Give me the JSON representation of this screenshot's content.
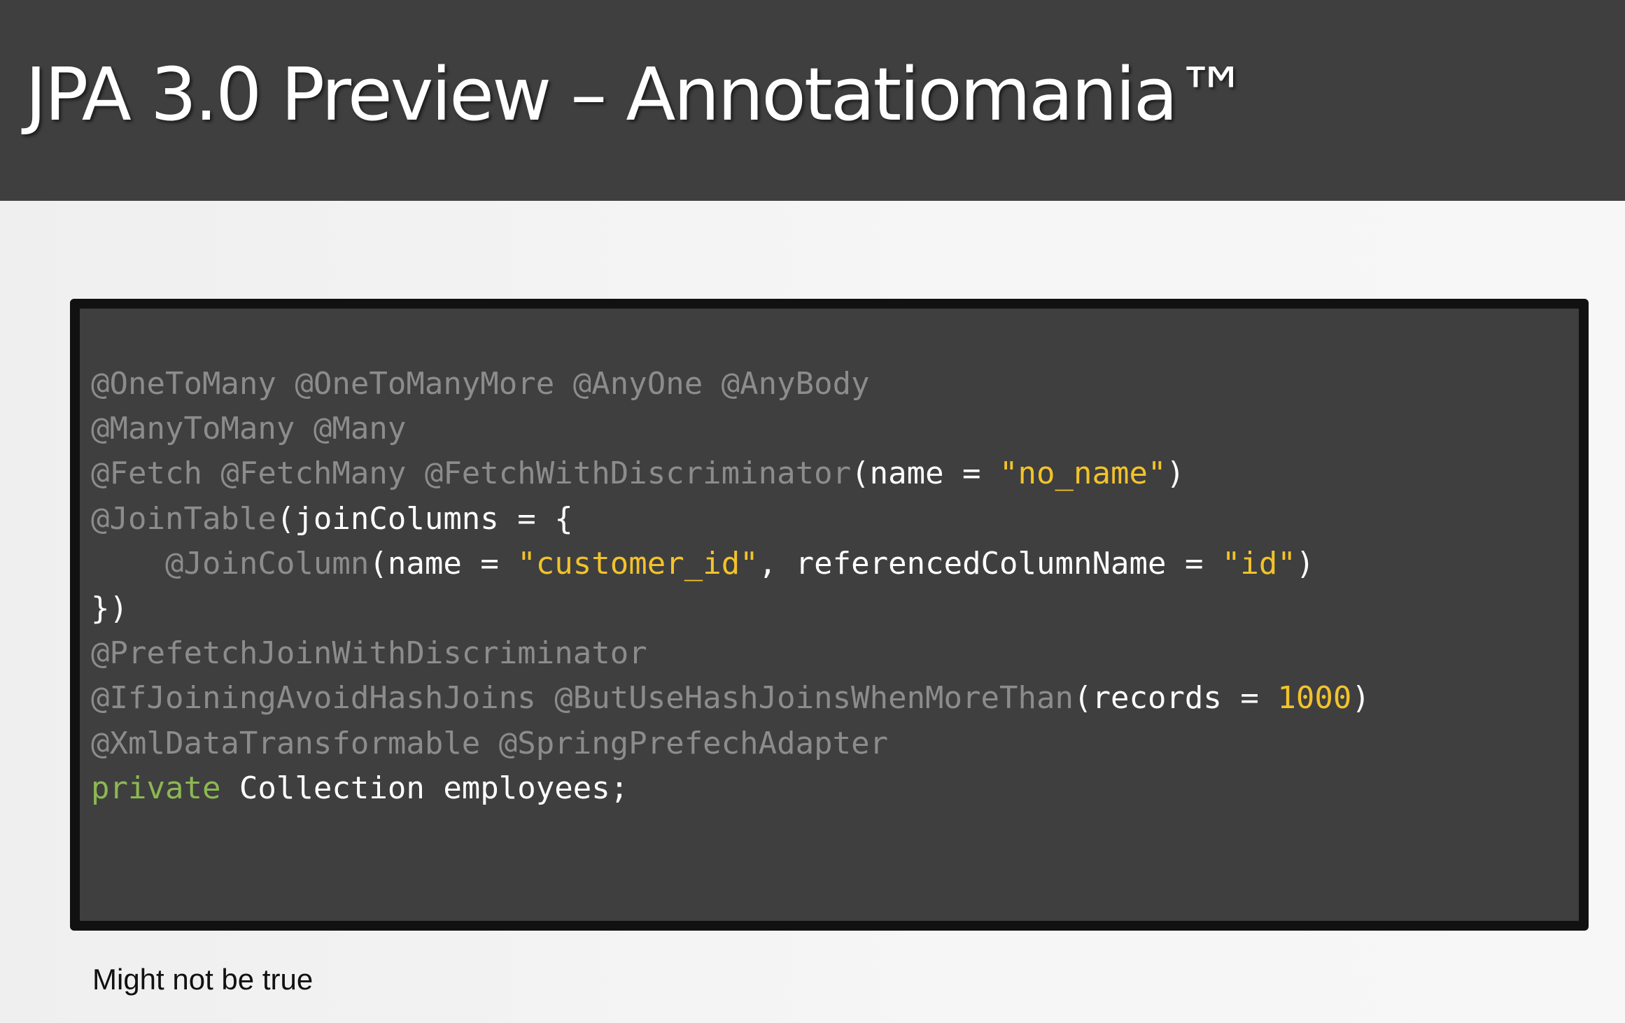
{
  "slide": {
    "title": "JPA 3.0 Preview – Annotatiomania™",
    "footnote": "Might not be true"
  },
  "code_block": {
    "lines": [
      [
        {
          "t": "anno",
          "text": "@OneToMany @OneToManyMore @AnyOne @AnyBody"
        }
      ],
      [
        {
          "t": "anno",
          "text": "@ManyToMany @Many"
        }
      ],
      [
        {
          "t": "anno",
          "text": "@Fetch @FetchMany @FetchWithDiscriminator"
        },
        {
          "t": "plain",
          "text": "(name = "
        },
        {
          "t": "str",
          "text": "\"no_name\""
        },
        {
          "t": "plain",
          "text": ")"
        }
      ],
      [
        {
          "t": "anno",
          "text": "@JoinTable"
        },
        {
          "t": "plain",
          "text": "(joinColumns = {"
        }
      ],
      [
        {
          "t": "plain",
          "text": "    "
        },
        {
          "t": "anno",
          "text": "@JoinColumn"
        },
        {
          "t": "plain",
          "text": "(name = "
        },
        {
          "t": "str",
          "text": "\"customer_id\""
        },
        {
          "t": "plain",
          "text": ", referencedColumnName = "
        },
        {
          "t": "str",
          "text": "\"id\""
        },
        {
          "t": "plain",
          "text": ")"
        }
      ],
      [
        {
          "t": "plain",
          "text": "})"
        }
      ],
      [
        {
          "t": "anno",
          "text": "@PrefetchJoinWithDiscriminator"
        }
      ],
      [
        {
          "t": "anno",
          "text": "@IfJoiningAvoidHashJoins @ButUseHashJoinsWhenMoreThan"
        },
        {
          "t": "plain",
          "text": "(records = "
        },
        {
          "t": "num",
          "text": "1000"
        },
        {
          "t": "plain",
          "text": ")"
        }
      ],
      [
        {
          "t": "anno",
          "text": "@XmlDataTransformable @SpringPrefechAdapter"
        }
      ],
      [
        {
          "t": "kw",
          "text": "private"
        },
        {
          "t": "plain",
          "text": " Collection employees;"
        }
      ]
    ]
  },
  "colors": {
    "title_bar": "#3f3f3f",
    "code_background": "#3f3f3f",
    "code_border": "#111111",
    "annotation": "#8c8c8c",
    "plain": "#ffffff",
    "string": "#f2c32a",
    "number": "#f2c32a",
    "keyword": "#8cb852"
  }
}
